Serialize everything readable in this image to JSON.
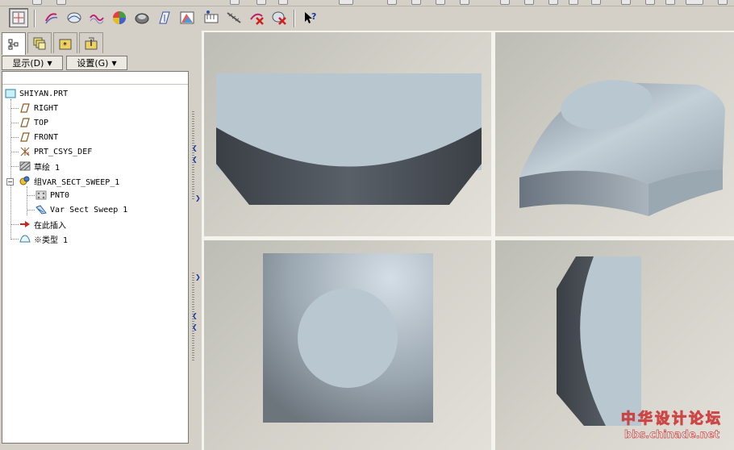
{
  "toolbar": {
    "icons": [
      "view-manager-icon",
      "sketch-datum-curve-icon",
      "sweep-surface-icon",
      "datum-curve-icon",
      "color-appearance-icon",
      "saved-view-icon",
      "datum-plane-icon",
      "analysis-icon",
      "datum-point-icon",
      "measure-icon",
      "delete-analysis-icon",
      "delete-all-icon",
      "context-help-icon"
    ]
  },
  "panel_tabs": [
    "model-tree-icon",
    "layer-tree-icon",
    "favorites-icon",
    "tools-icon"
  ],
  "menus": {
    "show_label": "显示(D)",
    "settings_label": "设置(G)"
  },
  "tree": {
    "root": "SHIYAN.PRT",
    "items": [
      {
        "label": "RIGHT",
        "icon": "datum-plane-icon"
      },
      {
        "label": "TOP",
        "icon": "datum-plane-icon"
      },
      {
        "label": "FRONT",
        "icon": "datum-plane-icon"
      },
      {
        "label": "PRT_CSYS_DEF",
        "icon": "coordinate-system-icon"
      },
      {
        "label": "草绘 1",
        "icon": "sketch-icon"
      },
      {
        "label": "组VAR_SECT_SWEEP_1",
        "icon": "group-icon"
      },
      {
        "label": "PNT0",
        "icon": "datum-point-icon"
      },
      {
        "label": "Var Sect Sweep 1",
        "icon": "variable-section-sweep-icon"
      },
      {
        "label": "在此插入",
        "icon": "insert-here-arrow-icon"
      },
      {
        "label": "※类型 1",
        "icon": "surface-icon"
      }
    ]
  },
  "colors": {
    "background": "#d4d0c8",
    "viewport_bg": "#cfcdc4",
    "model_light": "#b8c6cf",
    "model_dark": "#454a50",
    "watermark": "#c82828"
  },
  "watermark": {
    "title": "中华设计论坛",
    "url": "bbs.chinade.net"
  }
}
